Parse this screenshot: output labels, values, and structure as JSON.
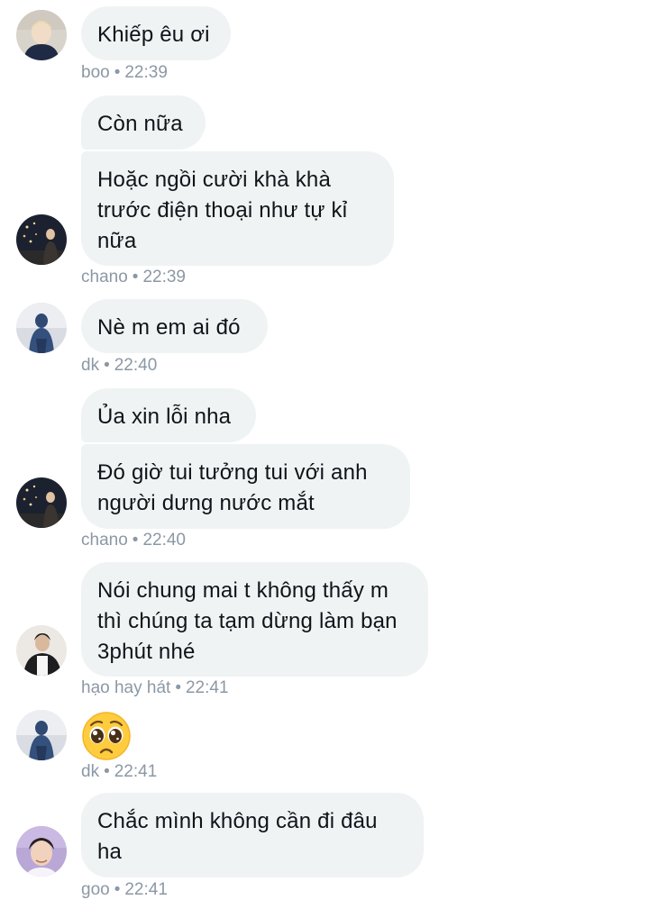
{
  "messages": [
    {
      "text": "Khiếp êu ơi",
      "sender": "boo",
      "time": "22:39"
    },
    {
      "text": "Còn nữa"
    },
    {
      "text": "Hoặc ngồi cười khà khà trước điện thoại như tự kỉ nữa",
      "sender": "chano",
      "time": "22:39"
    },
    {
      "text": "Nè m em ai đó",
      "sender": "dk",
      "time": "22:40"
    },
    {
      "text": "Ủa xin lỗi nha"
    },
    {
      "text": "Đó giờ tui tưởng tui với anh người dưng nước mắt",
      "sender": "chano",
      "time": "22:40"
    },
    {
      "text": "Nói chung mai t không thấy m thì chúng ta tạm dừng làm bạn 3phút nhé",
      "sender": "hạo hay hát",
      "time": "22:41"
    },
    {
      "emoji": "pleading-face",
      "sender": "dk",
      "time": "22:41"
    },
    {
      "text": "Chắc mình không cần đi đâu ha",
      "sender": "goo",
      "time": "22:41"
    }
  ],
  "meta_separator": "•",
  "colors": {
    "bubble_background": "#eff3f4",
    "text": "#0f1419",
    "meta_text": "#8b98a5"
  }
}
